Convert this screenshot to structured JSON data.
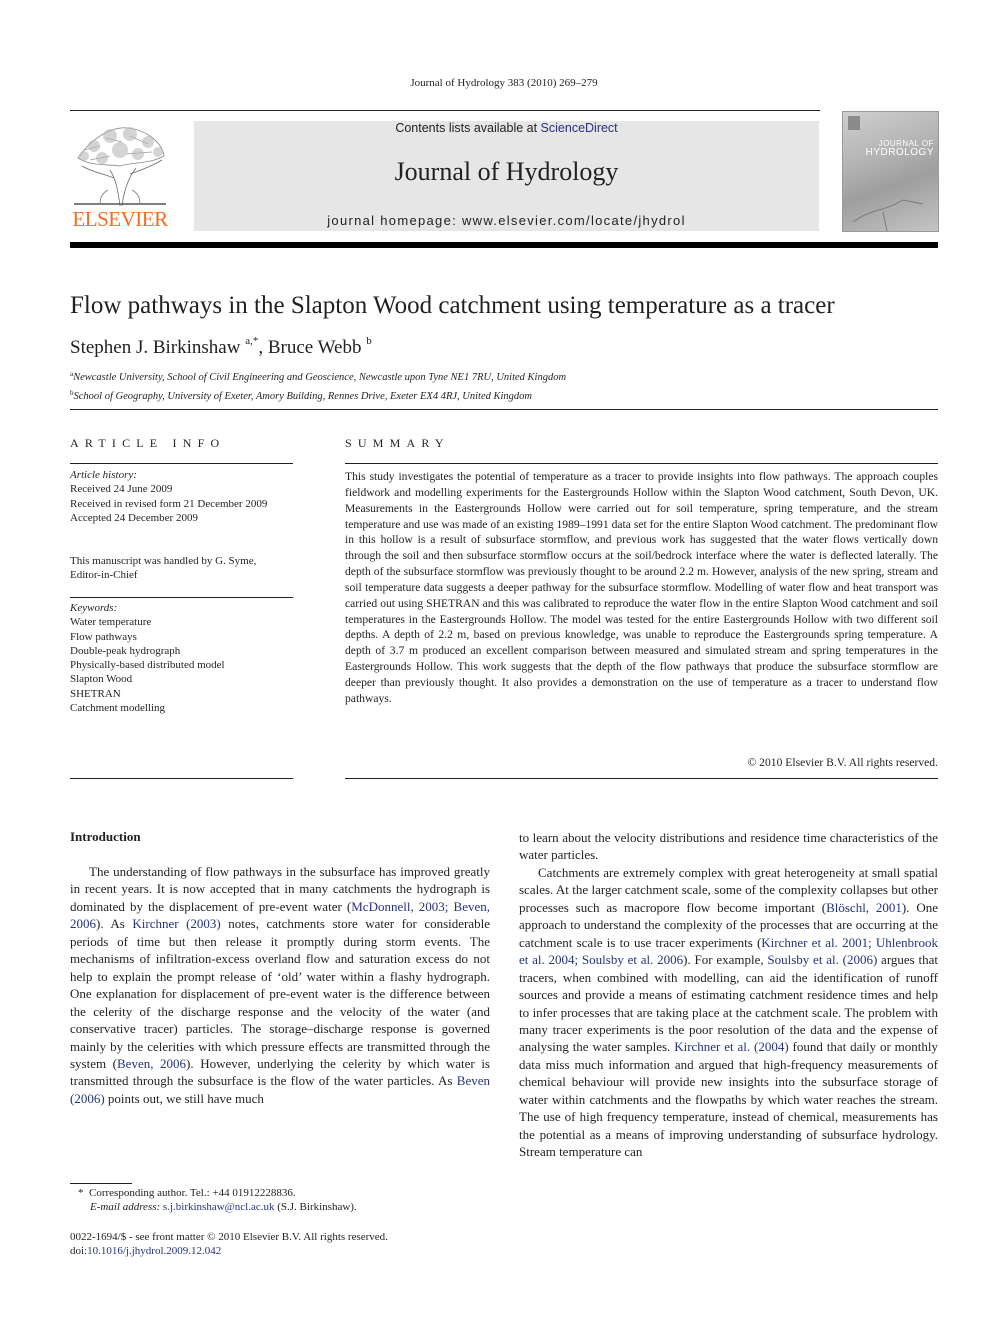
{
  "running_head": "Journal of Hydrology 383 (2010) 269–279",
  "masthead": {
    "contents_prefix": "Contents lists available at ",
    "contents_link": "ScienceDirect",
    "journal_name": "Journal of Hydrology",
    "homepage_label": "journal homepage: ",
    "homepage_url": "www.elsevier.com/locate/jhydrol",
    "publisher_wordmark": "ELSEVIER",
    "cover_title_line1": "JOURNAL OF",
    "cover_title_line2": "HYDROLOGY",
    "brand_color": "#f36d21",
    "link_color": "#25337e",
    "masthead_bg": "#e6e6e6"
  },
  "article": {
    "title": "Flow pathways in the Slapton Wood catchment using temperature as a tracer",
    "authors": [
      {
        "name": "Stephen J. Birkinshaw",
        "sup": "a,*"
      },
      {
        "name": "Bruce Webb",
        "sup": "b"
      }
    ],
    "author_separator": ", ",
    "affiliations": [
      {
        "sup": "a",
        "text": "Newcastle University, School of Civil Engineering and Geoscience, Newcastle upon Tyne NE1 7RU, United Kingdom"
      },
      {
        "sup": "b",
        "text": "School of Geography, University of Exeter, Amory Building, Rennes Drive, Exeter EX4 4RJ, United Kingdom"
      }
    ]
  },
  "article_info": {
    "heading": "ARTICLE INFO",
    "history_label": "Article history:",
    "history": [
      "Received 24 June 2009",
      "Received in revised form 21 December 2009",
      "Accepted 24 December 2009"
    ],
    "handled_line1": "This manuscript was handled by G. Syme,",
    "handled_line2": "Editor-in-Chief",
    "keywords_label": "Keywords:",
    "keywords": [
      "Water temperature",
      "Flow pathways",
      "Double-peak hydrograph",
      "Physically-based distributed model",
      "Slapton Wood",
      "SHETRAN",
      "Catchment modelling"
    ]
  },
  "summary": {
    "heading": "SUMMARY",
    "body": "This study investigates the potential of temperature as a tracer to provide insights into flow pathways. The approach couples fieldwork and modelling experiments for the Eastergrounds Hollow within the Slapton Wood catchment, South Devon, UK. Measurements in the Eastergrounds Hollow were carried out for soil temperature, spring temperature, and the stream temperature and use was made of an existing 1989–1991 data set for the entire Slapton Wood catchment. The predominant flow in this hollow is a result of subsurface stormflow, and previous work has suggested that the water flows vertically down through the soil and then subsurface stormflow occurs at the soil/bedrock interface where the water is deflected laterally. The depth of the subsurface stormflow was previously thought to be around 2.2 m. However, analysis of the new spring, stream and soil temperature data suggests a deeper pathway for the subsurface stormflow. Modelling of water flow and heat transport was carried out using SHETRAN and this was calibrated to reproduce the water flow in the entire Slapton Wood catchment and soil temperatures in the Eastergrounds Hollow. The model was tested for the entire Eastergrounds Hollow with two different soil depths. A depth of 2.2 m, based on previous knowledge, was unable to reproduce the Eastergrounds spring temperature. A depth of 3.7 m produced an excellent comparison between measured and simulated stream and spring temperatures in the Eastergrounds Hollow. This work suggests that the depth of the flow pathways that produce the subsurface stormflow are deeper than previously thought. It also provides a demonstration on the use of temperature as a tracer to understand flow pathways.",
    "copyright": "© 2010 Elsevier B.V. All rights reserved."
  },
  "introduction": {
    "heading": "Introduction",
    "left_para": [
      {
        "t": "The understanding of flow pathways in the subsurface has improved greatly in recent years. It is now accepted that in many catchments the hydrograph is dominated by the displacement of pre-event water ("
      },
      {
        "link": "McDonnell, 2003; Beven, 2006"
      },
      {
        "t": "). As "
      },
      {
        "link": "Kirchner (2003)"
      },
      {
        "t": " notes, catchments store water for considerable periods of time but then release it promptly during storm events. The mechanisms of infiltration-excess overland flow and saturation excess do not help to explain the prompt release of ‘old’ water within a flashy hydrograph. One explanation for displacement of pre-event water is the difference between the celerity of the discharge response and the velocity of the water (and conservative tracer) particles. The storage–discharge response is governed mainly by the celerities with which pressure effects are transmitted through the system ("
      },
      {
        "link": "Beven, 2006"
      },
      {
        "t": "). However, underlying the celerity by which water is transmitted through the subsurface is the flow of the water particles. As "
      },
      {
        "link": "Beven (2006)"
      },
      {
        "t": " points out, we still have much"
      }
    ],
    "right_para1": "to learn about the velocity distributions and residence time characteristics of the water particles.",
    "right_para2": [
      {
        "t": "Catchments are extremely complex with great heterogeneity at small spatial scales. At the larger catchment scale, some of the complexity collapses but other processes such as macropore flow become important ("
      },
      {
        "link": "Blöschl, 2001"
      },
      {
        "t": "). One approach to understand the complexity of the processes that are occurring at the catchment scale is to use tracer experiments ("
      },
      {
        "link": "Kirchner et al. 2001; Uhlenbrook et al. 2004; Soulsby et al. 2006"
      },
      {
        "t": "). For example, "
      },
      {
        "link": "Soulsby et al. (2006)"
      },
      {
        "t": " argues that tracers, when combined with modelling, can aid the identification of runoff sources and provide a means of estimating catchment residence times and help to infer processes that are taking place at the catchment scale. The problem with many tracer experiments is the poor resolution of the data and the expense of analysing the water samples. "
      },
      {
        "link": "Kirchner et al. (2004)"
      },
      {
        "t": " found that daily or monthly data miss much information and argued that high-frequency measurements of chemical behaviour will provide new insights into the subsurface storage of water within catchments and the flowpaths by which water reaches the stream. The use of high frequency temperature, instead of chemical, measurements has the potential as a means of improving understanding of subsurface hydrology. Stream temperature can"
      }
    ]
  },
  "footnote": {
    "marker": "*",
    "corresponding": "Corresponding author. Tel.: +44 01912228836.",
    "email_label": "E-mail address: ",
    "email": "s.j.birkinshaw@ncl.ac.uk",
    "email_suffix": " (S.J. Birkinshaw)."
  },
  "issn_line": "0022-1694/$ - see front matter © 2010 Elsevier B.V. All rights reserved.",
  "doi_label": "doi:",
  "doi": "10.1016/j.jhydrol.2009.12.042"
}
